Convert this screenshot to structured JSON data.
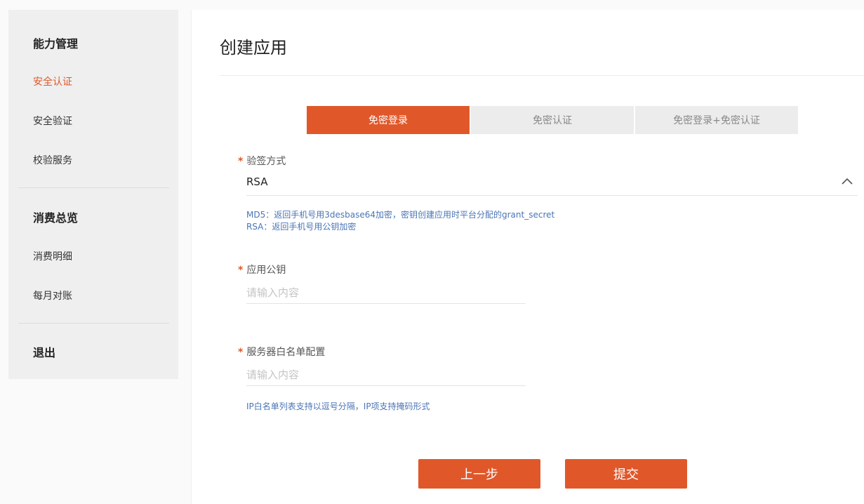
{
  "sidebar": {
    "sections": [
      {
        "title": "能力管理",
        "items": [
          {
            "label": "安全认证",
            "active": true
          },
          {
            "label": "安全验证",
            "active": false
          },
          {
            "label": "校验服务",
            "active": false
          }
        ]
      },
      {
        "title": "消费总览",
        "items": [
          {
            "label": "消费明细",
            "active": false
          },
          {
            "label": "每月对账",
            "active": false
          }
        ]
      },
      {
        "title": "退出",
        "items": []
      }
    ]
  },
  "main": {
    "title": "创建应用",
    "tabs": [
      {
        "label": "免密登录",
        "active": true
      },
      {
        "label": "免密认证",
        "active": false
      },
      {
        "label": "免密登录+免密认证",
        "active": false
      }
    ],
    "form": {
      "required_mark": "*",
      "sign_method": {
        "label": "验签方式",
        "value": "RSA",
        "hints": [
          "MD5：返回手机号用3desbase64加密，密钥创建应用时平台分配的grant_secret",
          "RSA：返回手机号用公钥加密"
        ]
      },
      "public_key": {
        "label": "应用公钥",
        "value": "",
        "placeholder": "请输入内容"
      },
      "whitelist": {
        "label": "服务器白名单配置",
        "value": "",
        "placeholder": "请输入内容",
        "hint": "IP白名单列表支持以逗号分隔，IP项支持掩码形式"
      }
    },
    "buttons": {
      "prev": "上一步",
      "submit": "提交"
    }
  },
  "colors": {
    "accent": "#e0582a",
    "hint": "#4a75b5",
    "sidebar_bg": "#efefef",
    "tab_inactive_bg": "#ececec"
  }
}
